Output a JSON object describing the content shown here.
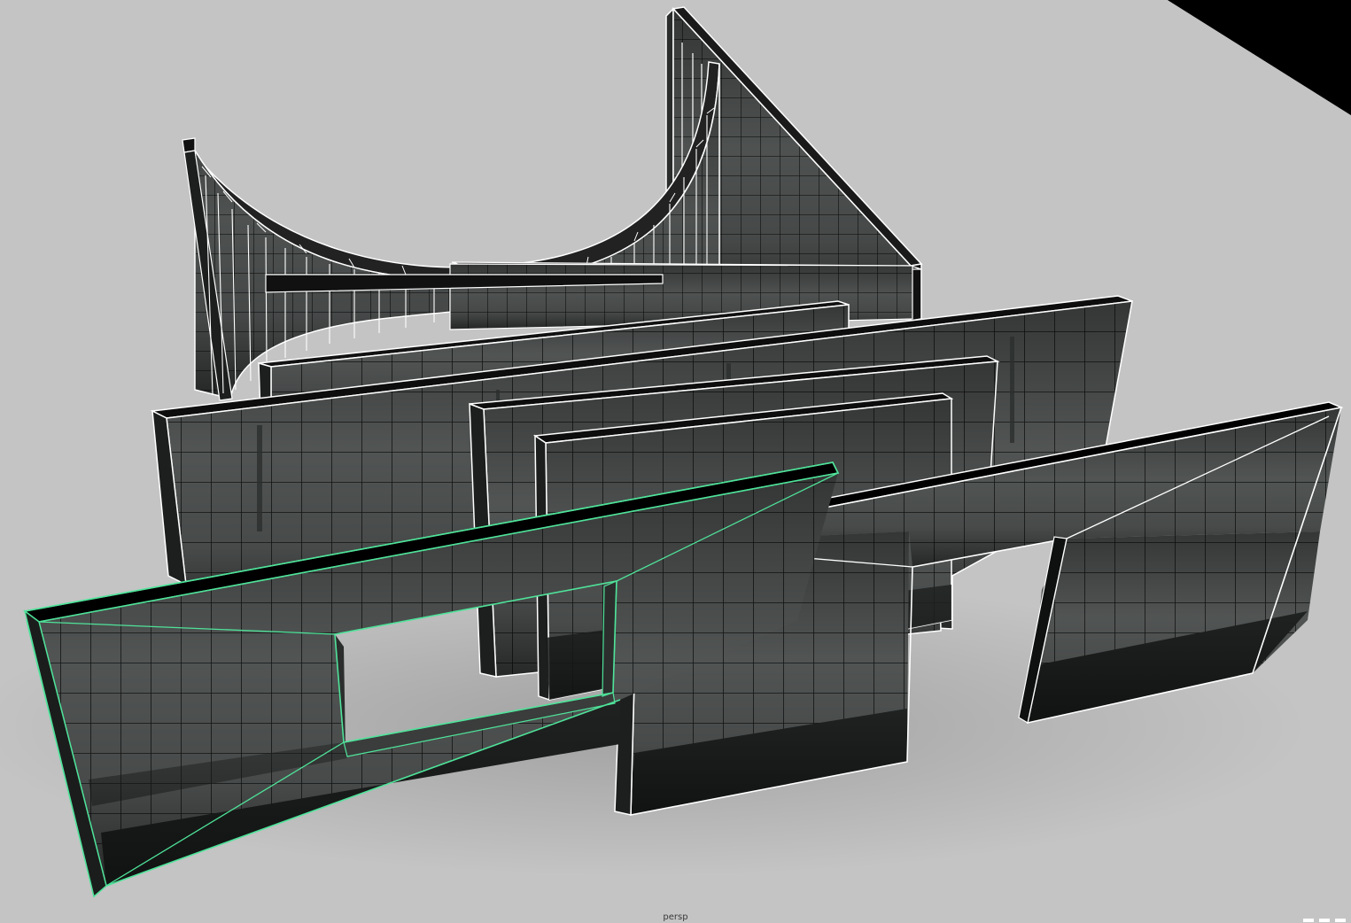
{
  "viewport": {
    "camera_label": "persp",
    "background_color": "#000000",
    "ground_color": "#c4c4c4",
    "wireframe_color": "#ffffff",
    "selection_color": "#4fe39a",
    "tile_face_color": "#6b6f6e",
    "tile_line_color": "#1a1c1c",
    "grime_color": "#222524"
  },
  "scene": {
    "objects": [
      {
        "name": "curved-wall",
        "selected": false
      },
      {
        "name": "corner-wall",
        "selected": false
      },
      {
        "name": "back-wall-thin",
        "selected": false
      },
      {
        "name": "mid-wall-left",
        "selected": false
      },
      {
        "name": "mid-wall-wide",
        "selected": false
      },
      {
        "name": "mid-wall-inner",
        "selected": false
      },
      {
        "name": "mid-wall-small",
        "selected": false
      },
      {
        "name": "window-wall",
        "selected": true
      },
      {
        "name": "doorway-wall",
        "selected": false
      }
    ]
  }
}
